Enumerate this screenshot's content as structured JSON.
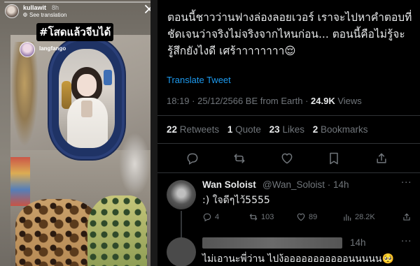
{
  "story": {
    "username": "kullawit",
    "time": "8h",
    "see_translation": "See translation",
    "caption": "#โสดแล้วจีบได้",
    "mention": "langfango"
  },
  "tweet": {
    "text": "ตอนนี้ชาวว่านฟางล่องลอยเวอร์ เราจะไปหาคำตอบที่ชัดเจนว่าจริงไม่จริงจากไหนก่อน... ตอนนี้คือไม่รู้จะรู้สึกยังไงดี เศร้าาาาาาาา😌",
    "translate_label": "Translate Tweet",
    "meta": {
      "time": "18:19",
      "date": "25/12/2566 BE from Earth",
      "views_count": "24.9K",
      "views_label": "Views"
    },
    "stats": {
      "retweets_count": "22",
      "retweets_label": "Retweets",
      "quotes_count": "1",
      "quotes_label": "Quote",
      "likes_count": "23",
      "likes_label": "Likes",
      "bookmarks_count": "2",
      "bookmarks_label": "Bookmarks"
    }
  },
  "reply": {
    "name": "Wan Soloist",
    "handle": "@Wan_Soloist · 14h",
    "text": ":) ใจดีๆไว้5555",
    "replies": "4",
    "retweets": "103",
    "likes": "89",
    "views": "28.2K"
  },
  "reply2": {
    "time": "14h",
    "text": "ไม่เอานะพี่ว่าน ไปง้อออออออออออนนนนน🥺"
  },
  "colors": {
    "accent": "#1d9bf0",
    "muted": "#71767b",
    "text": "#e7e9ea",
    "divider": "#2f3336"
  }
}
